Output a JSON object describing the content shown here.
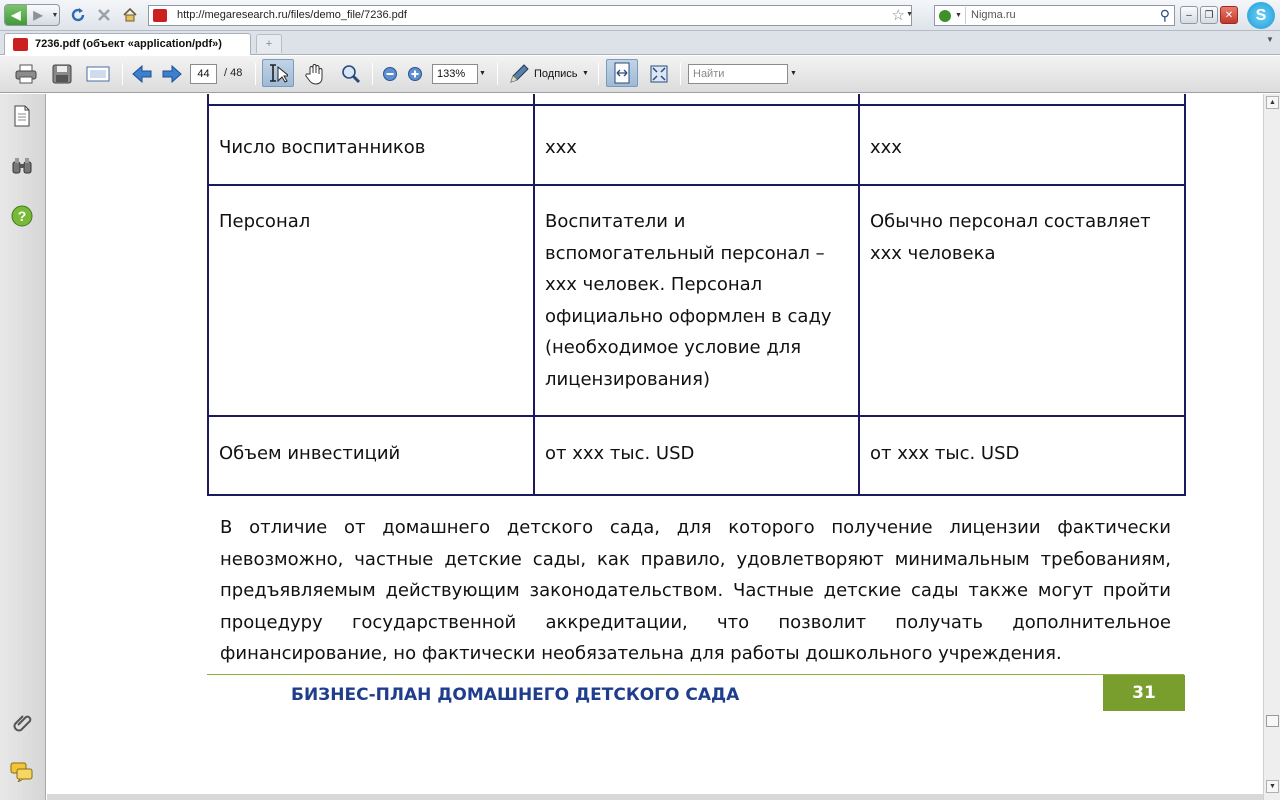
{
  "browser": {
    "address": "http://megaresearch.ru/files/demo_file/7236.pdf",
    "search_placeholder": "Nigma.ru",
    "tab_title": "7236.pdf (объект «application/pdf»)",
    "new_tab_label": "+"
  },
  "pdf_toolbar": {
    "page_current": "44",
    "page_total": "/ 48",
    "zoom": "133%",
    "sign_label": "Подпись",
    "find_placeholder": "Найти"
  },
  "table": {
    "rows": [
      {
        "label": "",
        "value1": "",
        "value2": ""
      },
      {
        "label": "Число воспитанников",
        "value1": "xxx",
        "value2": "xxx"
      },
      {
        "label": "Персонал",
        "value1": "Воспитатели и вспомогательный персонал – xxx человек. Персонал официально оформлен в саду (необходимое условие для лицензирования)",
        "value2": "Обычно персонал составляет xxx человека"
      },
      {
        "label": "Объем инвестиций",
        "value1": "от xxx тыс. USD",
        "value2": "от xxx тыс. USD"
      }
    ]
  },
  "paragraph": "В отличие от домашнего детского сада, для которого получение лицензии фактически невозможно, частные детские сады, как правило, удовлетворяют минимальным требованиям, предъявляемым действующим законодательством. Частные детские сады также могут пройти процедуру государственной аккредитации, что позволит получать дополнительное финансирование, но фактически необязательна для работы дошкольного учреждения.",
  "footer": {
    "title": "БИЗНЕС-ПЛАН ДОМАШНЕГО ДЕТСКОГО САДА",
    "page_number": "31"
  },
  "colors": {
    "table_border": "#1a1a5c",
    "footer_title": "#1f3d8c",
    "footer_accent": "#7a9e2e"
  }
}
